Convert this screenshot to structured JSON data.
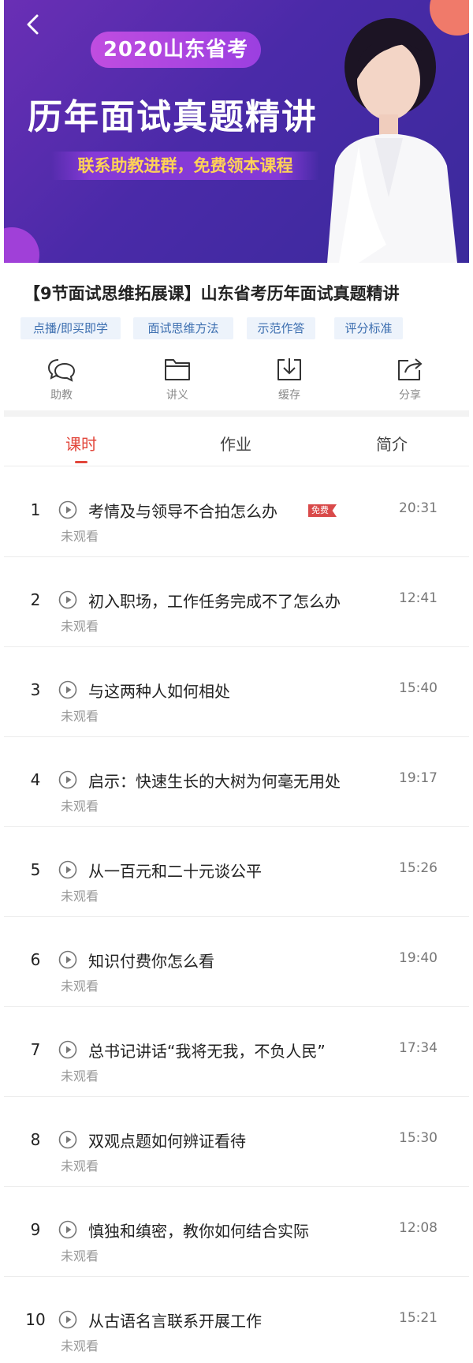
{
  "banner": {
    "pill": "2020山东省考",
    "headline": "历年面试真题精讲",
    "subline": "联系助教进群，免费领本课程"
  },
  "course": {
    "title": "【9节面试思维拓展课】山东省考历年面试真题精讲",
    "tags": [
      "点播/即买即学",
      "面试思维方法",
      "示范作答",
      "评分标准"
    ]
  },
  "actions": [
    {
      "label": "助教",
      "icon": "chat-icon"
    },
    {
      "label": "讲义",
      "icon": "folder-icon"
    },
    {
      "label": "缓存",
      "icon": "download-icon"
    },
    {
      "label": "分享",
      "icon": "share-icon"
    }
  ],
  "tabs": [
    {
      "label": "课时",
      "active": true
    },
    {
      "label": "作业",
      "active": false
    },
    {
      "label": "简介",
      "active": false
    }
  ],
  "lessons": [
    {
      "num": "1",
      "title": "考情及与领导不合拍怎么办",
      "free": "免费",
      "duration": "20:31",
      "status": "未观看"
    },
    {
      "num": "2",
      "title": "初入职场，工作任务完成不了怎么办",
      "duration": "12:41",
      "status": "未观看"
    },
    {
      "num": "3",
      "title": "与这两种人如何相处",
      "duration": "15:40",
      "status": "未观看"
    },
    {
      "num": "4",
      "title": "启示：快速生长的大树为何毫无用处",
      "duration": "19:17",
      "status": "未观看"
    },
    {
      "num": "5",
      "title": "从一百元和二十元谈公平",
      "duration": "15:26",
      "status": "未观看"
    },
    {
      "num": "6",
      "title": "知识付费你怎么看",
      "duration": "19:40",
      "status": "未观看"
    },
    {
      "num": "7",
      "title": "总书记讲话“我将无我，不负人民”",
      "duration": "17:34",
      "status": "未观看"
    },
    {
      "num": "8",
      "title": "双观点题如何辨证看待",
      "duration": "15:30",
      "status": "未观看"
    },
    {
      "num": "9",
      "title": "慎独和缜密，教你如何结合实际",
      "duration": "12:08",
      "status": "未观看"
    },
    {
      "num": "10",
      "title": "从古语名言联系开展工作",
      "duration": "15:21",
      "status": "未观看"
    }
  ],
  "colors": {
    "accent": "#e2463b",
    "tag_bg": "#edf3fb",
    "tag_text": "#3d6fb0",
    "banner": "#4a2aa8"
  }
}
